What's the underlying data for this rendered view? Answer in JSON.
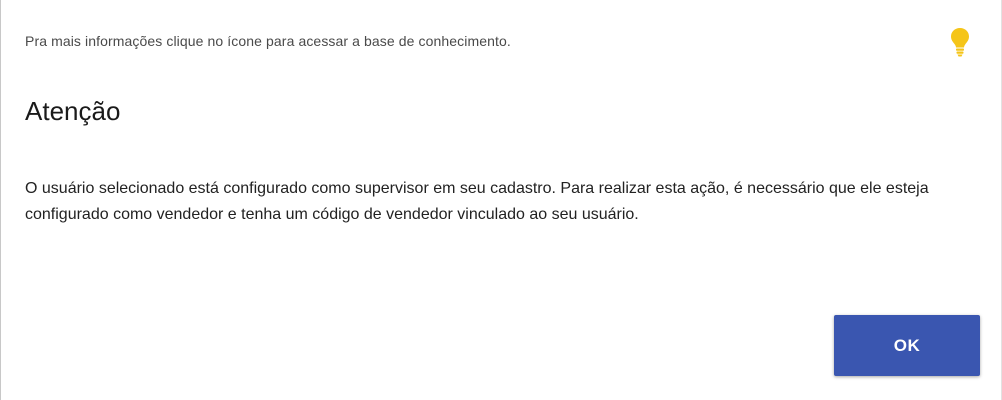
{
  "dialog": {
    "info_text": "Pra mais informações clique no ícone para acessar a base de conhecimento.",
    "info_icon": "lightbulb-icon",
    "info_icon_color": "#f5c518",
    "title": "Atenção",
    "message": "O usuário selecionado está configurado como supervisor em seu cadastro. Para realizar esta ação, é necessário que ele esteja configurado como vendedor e tenha um código de vendedor vinculado ao seu usuário.",
    "ok_label": "OK",
    "ok_color": "#3a56b0"
  }
}
